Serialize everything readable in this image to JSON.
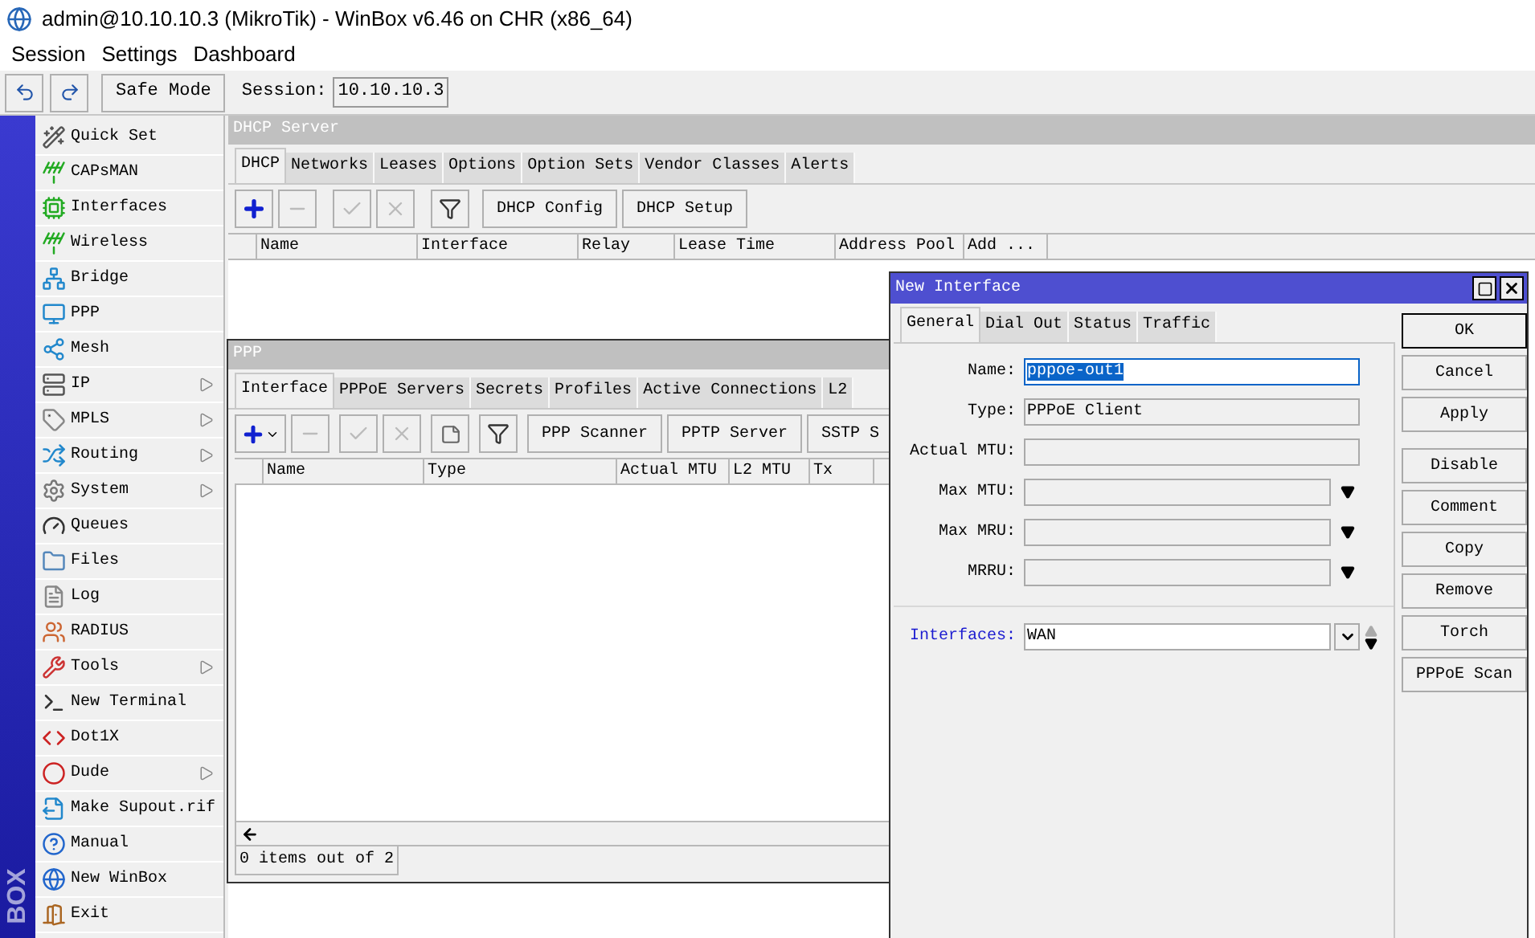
{
  "window": {
    "title": "admin@10.10.10.3 (MikroTik) - WinBox v6.46 on CHR (x86_64)"
  },
  "menu": [
    "Session",
    "Settings",
    "Dashboard"
  ],
  "toolbar": {
    "safe_mode": "Safe Mode",
    "session_label": "Session:",
    "session_value": "10.10.10.3"
  },
  "sidebar": {
    "brand": "BOX",
    "items": [
      {
        "label": "Quick Set",
        "submenu": false
      },
      {
        "label": "CAPsMAN",
        "submenu": false
      },
      {
        "label": "Interfaces",
        "submenu": false
      },
      {
        "label": "Wireless",
        "submenu": false
      },
      {
        "label": "Bridge",
        "submenu": false
      },
      {
        "label": "PPP",
        "submenu": false
      },
      {
        "label": "Mesh",
        "submenu": false
      },
      {
        "label": "IP",
        "submenu": true
      },
      {
        "label": "MPLS",
        "submenu": true
      },
      {
        "label": "Routing",
        "submenu": true
      },
      {
        "label": "System",
        "submenu": true
      },
      {
        "label": "Queues",
        "submenu": false
      },
      {
        "label": "Files",
        "submenu": false
      },
      {
        "label": "Log",
        "submenu": false
      },
      {
        "label": "RADIUS",
        "submenu": false
      },
      {
        "label": "Tools",
        "submenu": true
      },
      {
        "label": "New Terminal",
        "submenu": false
      },
      {
        "label": "Dot1X",
        "submenu": false
      },
      {
        "label": "Dude",
        "submenu": true
      },
      {
        "label": "Make Supout.rif",
        "submenu": false
      },
      {
        "label": "Manual",
        "submenu": false
      },
      {
        "label": "New WinBox",
        "submenu": false
      },
      {
        "label": "Exit",
        "submenu": false
      }
    ]
  },
  "dhcp_window": {
    "title": "DHCP Server",
    "tabs": [
      {
        "label": "DHCP",
        "selected": true
      },
      {
        "label": "Networks",
        "selected": false
      },
      {
        "label": "Leases",
        "selected": false
      },
      {
        "label": "Options",
        "selected": false
      },
      {
        "label": "Option Sets",
        "selected": false
      },
      {
        "label": "Vendor Classes",
        "selected": false
      },
      {
        "label": "Alerts",
        "selected": false
      }
    ],
    "buttons": [
      "DHCP Config",
      "DHCP Setup"
    ],
    "columns": [
      "Name",
      "Interface",
      "Relay",
      "Lease Time",
      "Address Pool",
      "Add ..."
    ]
  },
  "ppp_window": {
    "title": "PPP",
    "tabs": [
      {
        "label": "Interface",
        "selected": true
      },
      {
        "label": "PPPoE Servers",
        "selected": false
      },
      {
        "label": "Secrets",
        "selected": false
      },
      {
        "label": "Profiles",
        "selected": false
      },
      {
        "label": "Active Connections",
        "selected": false
      },
      {
        "label": "L2",
        "selected": false
      }
    ],
    "buttons": [
      "PPP Scanner",
      "PPTP Server",
      "SSTP S"
    ],
    "columns": [
      "Name",
      "Type",
      "Actual MTU",
      "L2 MTU",
      "Tx"
    ],
    "status": "0 items out of 2"
  },
  "dialog": {
    "title": "New Interface",
    "tabs": [
      {
        "label": "General",
        "selected": true
      },
      {
        "label": "Dial Out",
        "selected": false
      },
      {
        "label": "Status",
        "selected": false
      },
      {
        "label": "Traffic",
        "selected": false
      }
    ],
    "fields": [
      {
        "label": "Name:",
        "value": "pppoe-out1",
        "kind": "text",
        "text_selected": true
      },
      {
        "label": "Type:",
        "value": "PPPoE Client",
        "kind": "readonly",
        "text_selected": false
      },
      {
        "label": "Actual MTU:",
        "kind": "readonly",
        "text_selected": false
      },
      {
        "label": "Max MTU:",
        "kind": "dropdown",
        "text_selected": false
      },
      {
        "label": "Max MRU:",
        "kind": "dropdown",
        "text_selected": false
      },
      {
        "label": "MRRU:",
        "kind": "dropdown",
        "text_selected": false
      },
      {
        "label": "Interfaces:",
        "value": "WAN",
        "kind": "multi",
        "text_selected": false
      }
    ],
    "buttons": [
      "OK",
      "Cancel",
      "Apply",
      "Disable",
      "Comment",
      "Copy",
      "Remove",
      "Torch",
      "PPPoE Scan"
    ]
  }
}
